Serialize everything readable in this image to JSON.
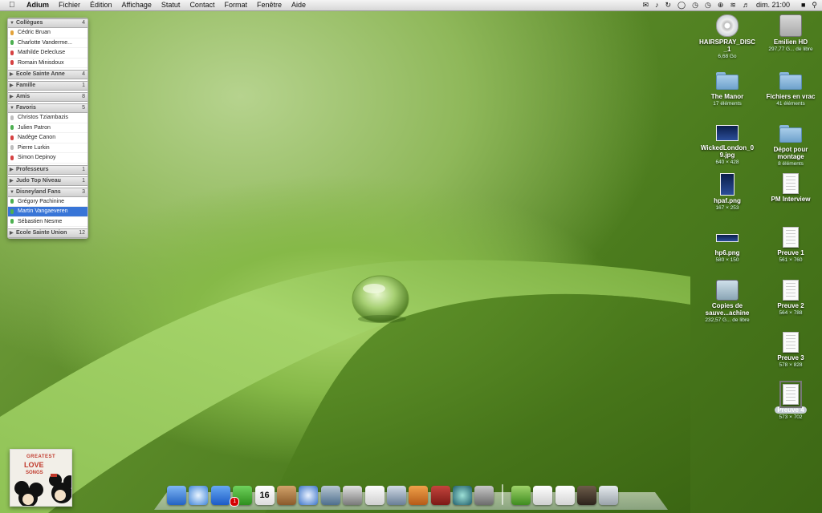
{
  "menubar": {
    "app_name": "Adium",
    "menus": [
      "Fichier",
      "Édition",
      "Affichage",
      "Statut",
      "Contact",
      "Format",
      "Fenêtre",
      "Aide"
    ],
    "clock": "dim. 21:00"
  },
  "buddy_list": {
    "groups": [
      {
        "name": "Collègues",
        "count": "4",
        "expanded": true,
        "buddies": [
          {
            "name": "Cédric Bruan",
            "status_color": "#e2a23a"
          },
          {
            "name": "Charlotte Vanderme...",
            "status_color": "#4caf50"
          },
          {
            "name": "Mathilde Delecluse",
            "status_color": "#d64141"
          },
          {
            "name": "Romain Minisdoux",
            "status_color": "#d64141"
          }
        ]
      },
      {
        "name": "Ecole Sainte Anne",
        "count": "4",
        "expanded": false,
        "buddies": []
      },
      {
        "name": "Famille",
        "count": "1",
        "expanded": false,
        "buddies": []
      },
      {
        "name": "Amis",
        "count": "8",
        "expanded": false,
        "buddies": []
      },
      {
        "name": "Favoris",
        "count": "5",
        "expanded": true,
        "buddies": [
          {
            "name": "Christos Tziambazis",
            "status_color": "#bdbdbd"
          },
          {
            "name": "Julien Patron",
            "status_color": "#4caf50"
          },
          {
            "name": "Nadège Canon",
            "status_color": "#d64141"
          },
          {
            "name": "Pierre Lurkin",
            "status_color": "#bdbdbd"
          },
          {
            "name": "Simon Depinoy",
            "status_color": "#d64141"
          }
        ]
      },
      {
        "name": "Professeurs",
        "count": "1",
        "expanded": false,
        "buddies": []
      },
      {
        "name": "Judo Top Niveau",
        "count": "1",
        "expanded": false,
        "buddies": []
      },
      {
        "name": "Disneyland Fans",
        "count": "3",
        "expanded": true,
        "buddies": [
          {
            "name": "Grégory Pachinine",
            "status_color": "#4caf50"
          },
          {
            "name": "Martin Vangaeveren",
            "status_color": "#4caf50",
            "selected": true
          },
          {
            "name": "Sébastien Nesme",
            "status_color": "#4caf50"
          }
        ]
      },
      {
        "name": "Ecole Sainte Union",
        "count": "12",
        "expanded": false,
        "buddies": []
      }
    ]
  },
  "desktop_icons": [
    {
      "name": "HAIRSPRAY_DISC _1",
      "sub": "6,68 Go",
      "kind": "disc-icon"
    },
    {
      "name": "Emilien HD",
      "sub": "297,77 G... de libre",
      "kind": "hard-drive-icon"
    },
    {
      "name": "The Manor",
      "sub": "17 éléments",
      "kind": "folder-icon"
    },
    {
      "name": "Fichiers en vrac",
      "sub": "41 éléments",
      "kind": "folder-icon"
    },
    {
      "name": "WickedLondon_0 9.jpg",
      "sub": "640 × 428",
      "kind": "image-thumbnail"
    },
    {
      "name": "Dépot pour montage",
      "sub": "8 éléments",
      "kind": "folder-icon"
    },
    {
      "name": "hpaf.png",
      "sub": "167 × 253",
      "kind": "image-thumbnail"
    },
    {
      "name": "PM Interview",
      "sub": "",
      "kind": "document-icon"
    },
    {
      "name": "hp6.png",
      "sub": "580 × 150",
      "kind": "image-thumbnail"
    },
    {
      "name": "Preuve 1",
      "sub": "561 × 760",
      "kind": "document-icon"
    },
    {
      "name": "Copies de sauve...achine",
      "sub": "232,57 G... de libre",
      "kind": "time-machine-disk-icon"
    },
    {
      "name": "Preuve 2",
      "sub": "564 × 788",
      "kind": "document-icon"
    },
    {
      "name": "Preuve 3",
      "sub": "578 × 828",
      "kind": "document-icon"
    },
    {
      "name": "Preuve 4",
      "sub": "573 × 702",
      "kind": "document-icon",
      "selected": true
    }
  ],
  "album_art": {
    "line1": "GREATEST",
    "line2": "LOVE",
    "line3": "SONGS"
  },
  "dock": {
    "items": [
      "finder-icon",
      "safari-icon",
      "ichat-icon",
      "adium-icon",
      "ical-icon",
      "address-book-icon",
      "itunes-icon",
      "iphoto-icon",
      "imovie-icon",
      "textedit-icon",
      "script-editor-icon",
      "keynote-icon",
      "dictionary-icon",
      "time-machine-icon",
      "system-preferences-icon"
    ],
    "right_items": [
      "applications-folder-icon",
      "documents-stack-icon",
      "downloads-stack-icon",
      "user-photo-icon",
      "trash-icon"
    ],
    "adium_badge": "1",
    "ical_date": "16"
  }
}
